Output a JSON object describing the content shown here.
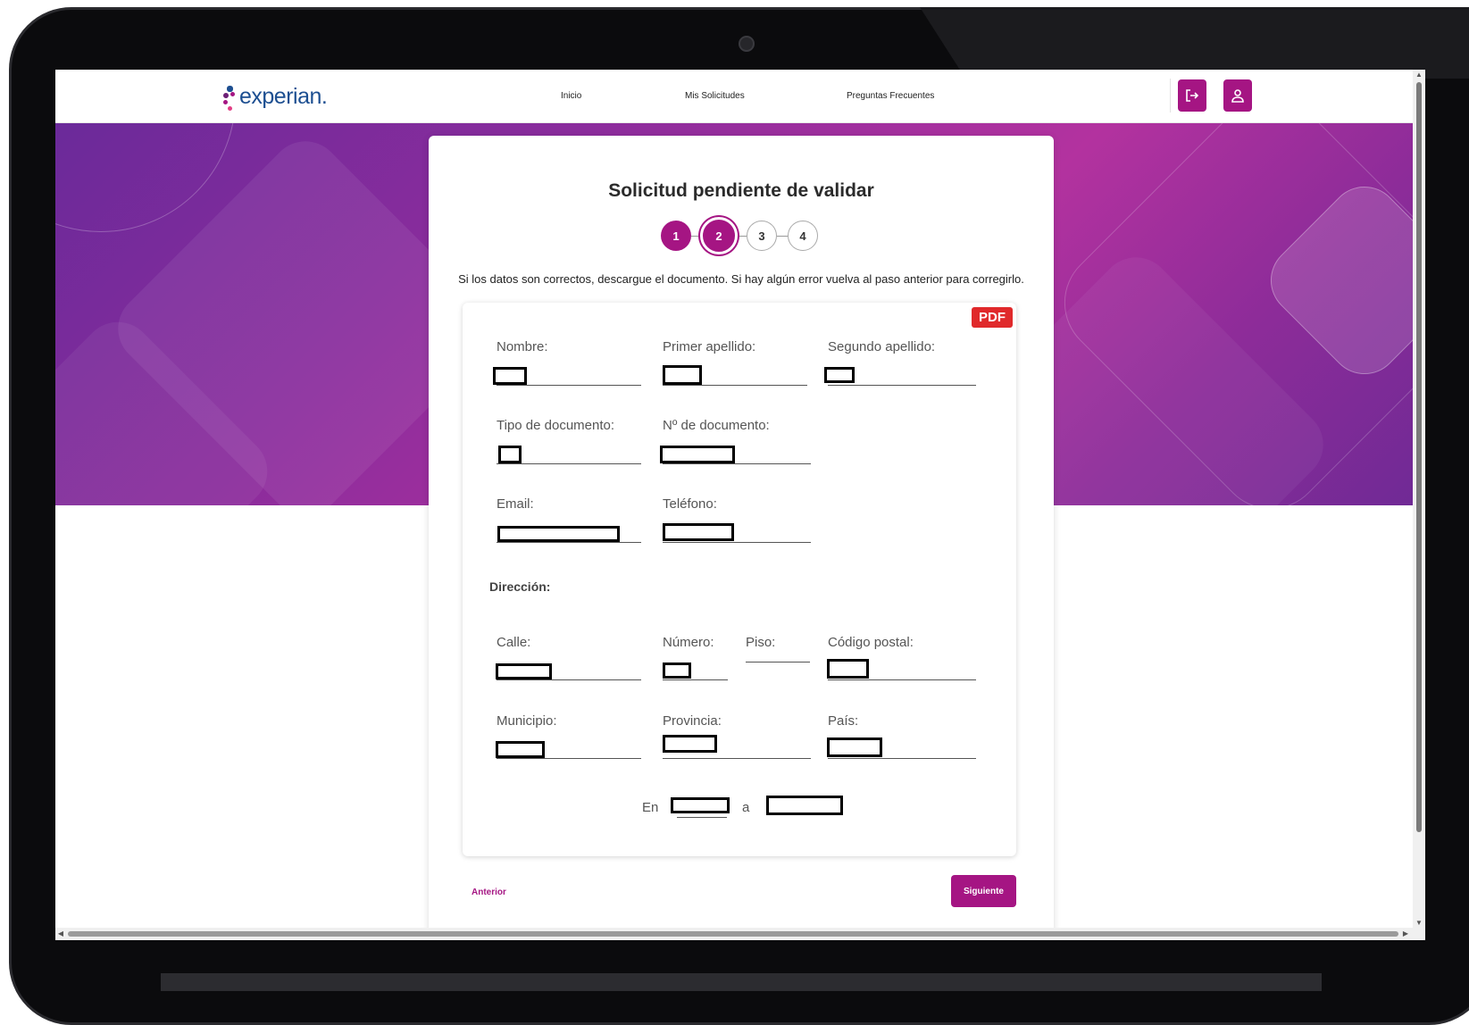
{
  "brand": {
    "logo_text": "experian.",
    "dot_colors": [
      "#1d4f91",
      "#a51583",
      "#e23e85",
      "#6d2077"
    ]
  },
  "colors": {
    "accent": "#a51583",
    "pdf_red": "#e0292b",
    "text": "#2b2b2b"
  },
  "nav": {
    "items": [
      "Inicio",
      "Mis Solicitudes",
      "Preguntas Frecuentes"
    ]
  },
  "header_icons": {
    "logout": "logout-icon",
    "profile": "user-icon"
  },
  "page": {
    "title": "Solicitud pendiente de validar",
    "instructions": "Si los datos son correctos, descargue el documento. Si hay algún error vuelva al paso anterior para corregirlo.",
    "steps": [
      "1",
      "2",
      "3",
      "4"
    ],
    "current_step": 2
  },
  "document": {
    "badge": "PDF",
    "labels": {
      "nombre": "Nombre:",
      "primer_apellido": "Primer apellido:",
      "segundo_apellido": "Segundo apellido:",
      "tipo_documento": "Tipo de documento:",
      "num_documento": "Nº de documento:",
      "email": "Email:",
      "telefono": "Teléfono:",
      "direccion": "Dirección:",
      "calle": "Calle:",
      "numero": "Número:",
      "piso": "Piso:",
      "codigo_postal": "Código postal:",
      "municipio": "Municipio:",
      "provincia": "Provincia:",
      "pais": "País:"
    },
    "footer": {
      "en": "En",
      "a": "a"
    }
  },
  "actions": {
    "prev": "Anterior",
    "next": "Siguiente"
  }
}
